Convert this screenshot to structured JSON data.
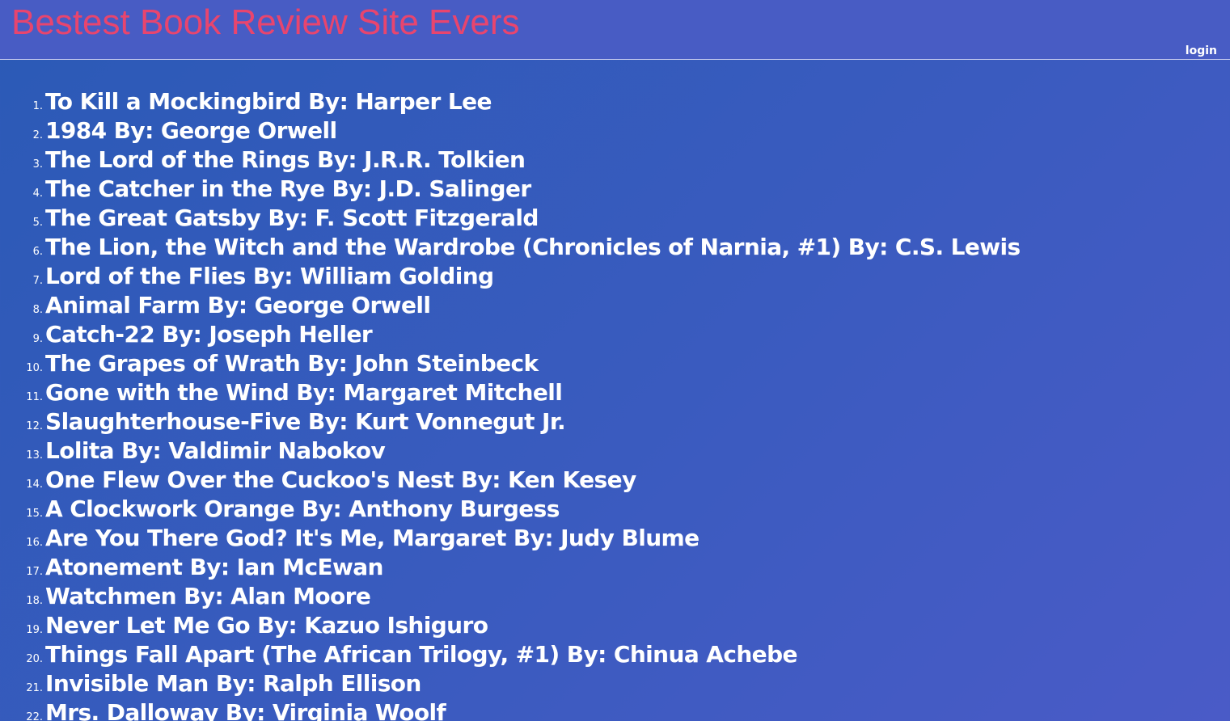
{
  "header": {
    "title": "Bestest Book Review Site Evers",
    "login_label": "login"
  },
  "books": [
    {
      "num": "1.",
      "text": "To Kill a Mockingbird By: Harper Lee"
    },
    {
      "num": "2.",
      "text": "1984 By: George Orwell"
    },
    {
      "num": "3.",
      "text": "The Lord of the Rings By: J.R.R. Tolkien"
    },
    {
      "num": "4.",
      "text": "The Catcher in the Rye By: J.D. Salinger"
    },
    {
      "num": "5.",
      "text": "The Great Gatsby By: F. Scott Fitzgerald"
    },
    {
      "num": "6.",
      "text": "The Lion, the Witch and the Wardrobe (Chronicles of Narnia, #1) By: C.S. Lewis"
    },
    {
      "num": "7.",
      "text": "Lord of the Flies By: William Golding"
    },
    {
      "num": "8.",
      "text": "Animal Farm By: George Orwell"
    },
    {
      "num": "9.",
      "text": "Catch-22 By: Joseph Heller"
    },
    {
      "num": "10.",
      "text": "The Grapes of Wrath By: John Steinbeck"
    },
    {
      "num": "11.",
      "text": "Gone with the Wind By: Margaret Mitchell"
    },
    {
      "num": "12.",
      "text": "Slaughterhouse-Five By: Kurt Vonnegut Jr."
    },
    {
      "num": "13.",
      "text": "Lolita By: Valdimir Nabokov"
    },
    {
      "num": "14.",
      "text": "One Flew Over the Cuckoo's Nest By: Ken Kesey"
    },
    {
      "num": "15.",
      "text": "A Clockwork Orange By: Anthony Burgess"
    },
    {
      "num": "16.",
      "text": "Are You There God? It's Me, Margaret By: Judy Blume"
    },
    {
      "num": "17.",
      "text": "Atonement By: Ian McEwan"
    },
    {
      "num": "18.",
      "text": "Watchmen By: Alan Moore"
    },
    {
      "num": "19.",
      "text": "Never Let Me Go By: Kazuo Ishiguro"
    },
    {
      "num": "20.",
      "text": "Things Fall Apart (The African Trilogy, #1) By: Chinua Achebe"
    },
    {
      "num": "21.",
      "text": "Invisible Man By: Ralph Ellison"
    },
    {
      "num": "22.",
      "text": "Mrs. Dalloway By: Virginia Woolf"
    }
  ],
  "colors": {
    "title": "#e8456e",
    "header_bg": "#485cc4",
    "page_bg": "#3259b9",
    "text": "#ffffff"
  }
}
